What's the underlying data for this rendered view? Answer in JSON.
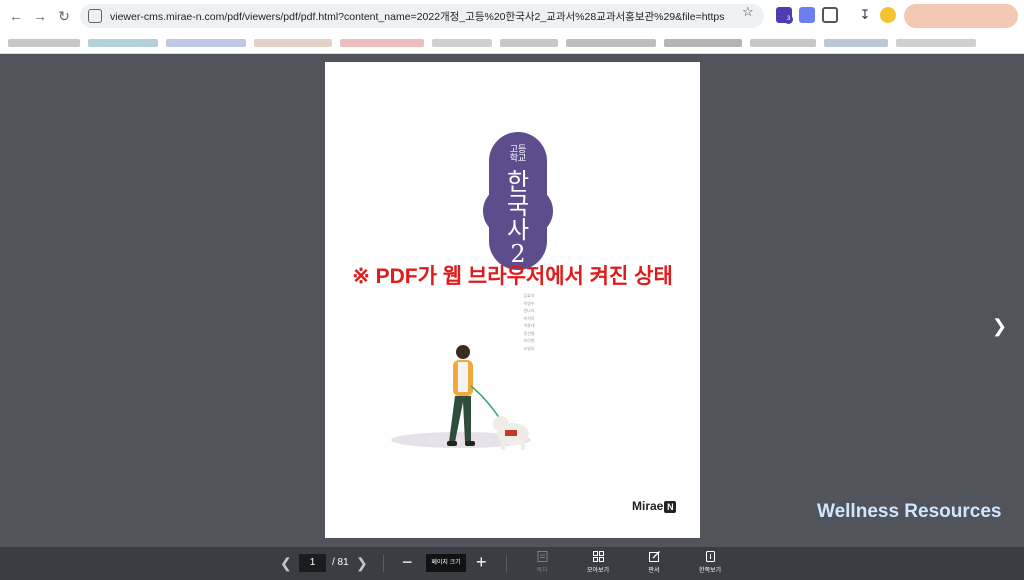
{
  "browser": {
    "url": "viewer-cms.mirae-n.com/pdf/viewers/pdf/pdf.html?content_name=2022개정_고등%20한국사2_교과서%28교과서홍보관%29&file=https://privw-cms...",
    "ext_badge": "3"
  },
  "cover": {
    "school_label": [
      "고등",
      "학교"
    ],
    "title_chars": [
      "한",
      "국",
      "사",
      "2"
    ],
    "authors": [
      "김효숙",
      "곽영수",
      "권나리",
      "박석욱",
      "이용대",
      "정선형",
      "조이현",
      "조영오"
    ],
    "publisher": "Mirae",
    "publisher_mark": "N"
  },
  "overlay_note": "※ PDF가 웹 브라우저에서 켜진 상태",
  "watermark": "Wellness Resources",
  "toolbar": {
    "current_page": "1",
    "total_pages": "/ 81",
    "zoom_label": "페이지 크기",
    "tools": [
      {
        "label": "목차",
        "icon": "document-list-icon",
        "enabled": false
      },
      {
        "label": "모아보기",
        "icon": "grid-icon",
        "enabled": true
      },
      {
        "label": "판서",
        "icon": "pen-edit-icon",
        "enabled": true
      },
      {
        "label": "한쪽보기",
        "icon": "single-page-icon",
        "enabled": true
      }
    ]
  }
}
